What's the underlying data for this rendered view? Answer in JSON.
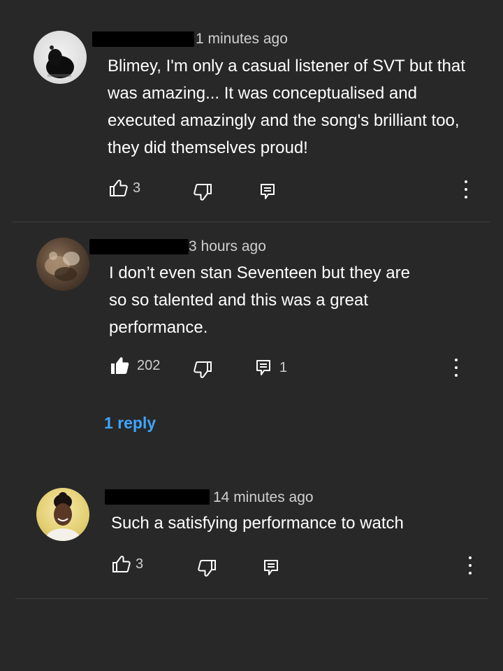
{
  "colors": {
    "background": "#282828",
    "text": "#ffffff",
    "meta": "#cfcfcf",
    "link": "#3ea6ff",
    "divider": "#3e3e3e"
  },
  "comments": [
    {
      "time": "1 minutes ago",
      "text": "Blimey, I'm only a casual listener of SVT but that was amazing... It was conceptualised and executed amazingly and the song's brilliant too, they did themselves proud!",
      "likes": "3",
      "replies": "",
      "liked": false
    },
    {
      "time": "3 hours ago",
      "text": "I don’t even stan Seventeen but they are so so talented and this was a great performance.",
      "likes": "202",
      "replies": "1",
      "liked": true,
      "reply_link": "1 reply"
    },
    {
      "time": "14 minutes ago",
      "text": "Such a satisfying performance to watch",
      "likes": "3",
      "replies": "",
      "liked": false
    }
  ],
  "icons": [
    "thumbs-up-icon",
    "thumbs-up-filled-icon",
    "thumbs-down-icon",
    "reply-icon",
    "more-vert-icon"
  ]
}
